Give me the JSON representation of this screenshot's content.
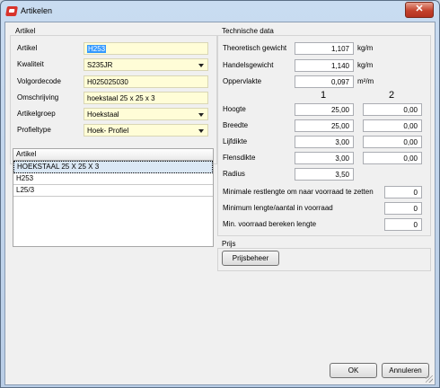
{
  "window": {
    "title": "Artikelen",
    "close_label": "✕"
  },
  "artikel": {
    "section_title": "Artikel",
    "fields": [
      {
        "label": "Artikel",
        "value": "H253"
      },
      {
        "label": "Kwaliteit",
        "value": "S235JR"
      },
      {
        "label": "Volgordecode",
        "value": "H025025030"
      },
      {
        "label": "Omschrijving",
        "value": "hoekstaal 25 x 25 x  3"
      },
      {
        "label": "Artikelgroep",
        "value": "Hoekstaal"
      },
      {
        "label": "Profieltype",
        "value": "Hoek- Profiel"
      }
    ]
  },
  "list": {
    "header": "Artikel",
    "rows": [
      "HOEKSTAAL 25 X 25 X  3",
      "H253",
      "L25/3"
    ]
  },
  "technische": {
    "section_title": "Technische data",
    "rows": [
      {
        "label": "Theoretisch gewicht",
        "value": "1,107",
        "unit": "kg/m"
      },
      {
        "label": "Handelsgewicht",
        "value": "1,140",
        "unit": "kg/m"
      },
      {
        "label": "Oppervlakte",
        "value": "0,097",
        "unit": "m²/m"
      }
    ],
    "col1": "1",
    "col2": "2",
    "dims": [
      {
        "label": "Hoogte",
        "v1": "25,00",
        "v2": "0,00"
      },
      {
        "label": "Breedte",
        "v1": "25,00",
        "v2": "0,00"
      },
      {
        "label": "Lijfdikte",
        "v1": "3,00",
        "v2": "0,00"
      },
      {
        "label": "Flensdikte",
        "v1": "3,00",
        "v2": "0,00"
      },
      {
        "label": "Radius",
        "v1": "3,50"
      }
    ],
    "extra": [
      {
        "label": "Minimale restlengte om naar voorraad te zetten",
        "value": "0"
      },
      {
        "label": "Minimum lengte/aantal in voorraad",
        "value": "0"
      },
      {
        "label": "Min. voorraad bereken lengte",
        "value": "0"
      }
    ]
  },
  "prijs": {
    "section_title": "Prijs",
    "button": "Prijsbeheer"
  },
  "footer": {
    "ok": "OK",
    "cancel": "Annuleren"
  }
}
